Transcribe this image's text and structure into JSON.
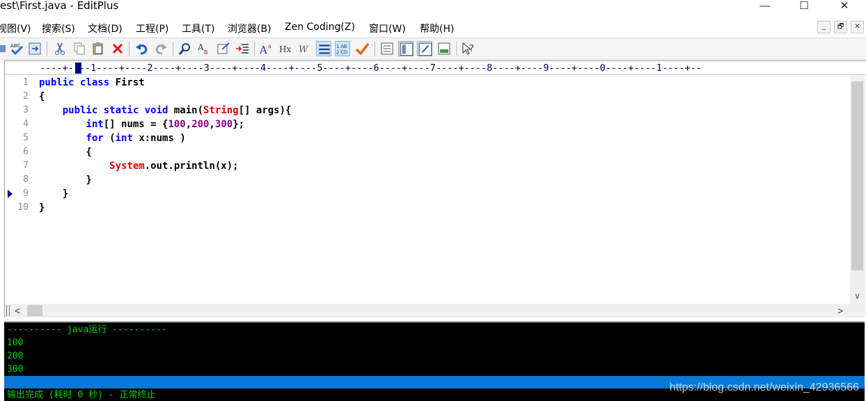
{
  "window": {
    "title": "est\\First.java - EditPlus",
    "minimize_glyph": "—",
    "maximize_glyph": "☐",
    "close_glyph": "✕"
  },
  "menubar": {
    "items": [
      "视图(V)",
      "搜索(S)",
      "文档(D)",
      "工程(P)",
      "工具(T)",
      "浏览器(B)",
      "Zen Coding(Z)",
      "窗口(W)",
      "帮助(H)"
    ],
    "mdi_minimize": "_",
    "mdi_restore": "🗗",
    "mdi_close": "✕"
  },
  "toolbar": {
    "icons": [
      "spellcheck-icon",
      "browser-view-icon",
      "cut-icon",
      "copy-icon",
      "paste-icon",
      "delete-icon",
      "undo-icon",
      "redo-icon",
      "find-icon",
      "replace-icon",
      "goto-icon",
      "indent-icon",
      "font-icon",
      "html-toolbar-icon",
      "word-wrap-icon",
      "line-wrap-icon",
      "line-numbers-icon",
      "check-icon",
      "cliptext-icon",
      "directory-icon",
      "output-window-icon",
      "tool-window-icon",
      "help-icon"
    ]
  },
  "editor": {
    "ruler": "----+----1----+----2----+----3----+----4----+----5----+----6----+----7----+----8----+----9----+----0----+----1----+--",
    "lines": [
      {
        "n": "1",
        "segments": [
          {
            "t": "public class ",
            "c": "kw"
          },
          {
            "t": "First",
            "c": ""
          }
        ]
      },
      {
        "n": "2",
        "segments": [
          {
            "t": "{",
            "c": ""
          }
        ]
      },
      {
        "n": "3",
        "segments": [
          {
            "t": "    ",
            "c": ""
          },
          {
            "t": "public static void ",
            "c": "kw"
          },
          {
            "t": "main(",
            "c": ""
          },
          {
            "t": "String",
            "c": "cls"
          },
          {
            "t": "[] args){",
            "c": ""
          }
        ]
      },
      {
        "n": "4",
        "segments": [
          {
            "t": "        ",
            "c": ""
          },
          {
            "t": "int",
            "c": "kw"
          },
          {
            "t": "[] nums = {",
            "c": ""
          },
          {
            "t": "100",
            "c": "num"
          },
          {
            "t": ",",
            "c": ""
          },
          {
            "t": "200",
            "c": "num"
          },
          {
            "t": ",",
            "c": ""
          },
          {
            "t": "300",
            "c": "num"
          },
          {
            "t": "};",
            "c": ""
          }
        ]
      },
      {
        "n": "5",
        "segments": [
          {
            "t": "        ",
            "c": ""
          },
          {
            "t": "for",
            "c": "kw"
          },
          {
            "t": " (",
            "c": ""
          },
          {
            "t": "int",
            "c": "kw"
          },
          {
            "t": " x:nums )",
            "c": ""
          }
        ]
      },
      {
        "n": "6",
        "segments": [
          {
            "t": "        {",
            "c": ""
          }
        ]
      },
      {
        "n": "7",
        "segments": [
          {
            "t": "            ",
            "c": ""
          },
          {
            "t": "System",
            "c": "cls"
          },
          {
            "t": ".out.println(x);",
            "c": ""
          }
        ]
      },
      {
        "n": "8",
        "segments": [
          {
            "t": "        }",
            "c": ""
          }
        ]
      },
      {
        "n": "9",
        "segments": [
          {
            "t": "    }",
            "c": ""
          }
        ]
      },
      {
        "n": "10",
        "segments": [
          {
            "t": "}",
            "c": ""
          }
        ]
      }
    ],
    "current_line_marker": "9",
    "hscroll_left": "<",
    "hscroll_right": ">",
    "vscroll_down": "∨"
  },
  "output": {
    "header": "---------- java运行 ----------",
    "lines": [
      "100",
      "200",
      "300"
    ],
    "status": "输出完成 (耗时 0 秒) - 正常终止",
    "watermark": "https://blog.csdn.net/weixin_42936566"
  }
}
